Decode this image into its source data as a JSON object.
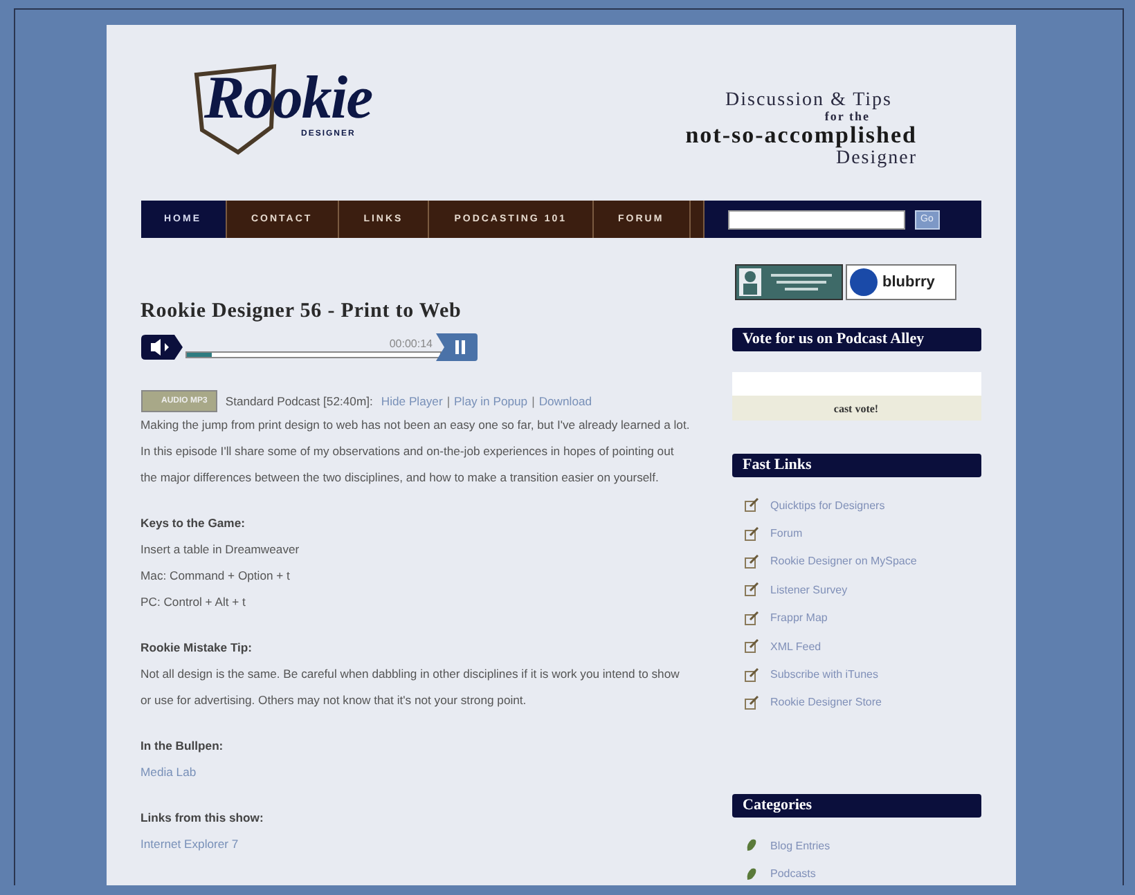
{
  "logo": {
    "word": "Rookie",
    "subword": "DESIGNER"
  },
  "tagline": {
    "lines": [
      {
        "text": "Discussion & Tips",
        "kind": "medium"
      },
      {
        "text": "for the",
        "kind": "small"
      },
      {
        "text": "not-so-accomplished",
        "kind": "large"
      },
      {
        "text": "Designer",
        "kind": "medium"
      }
    ]
  },
  "nav": {
    "items": [
      {
        "label": "HOME",
        "selected": true
      },
      {
        "label": "CONTACT",
        "selected": false
      },
      {
        "label": "LINKS",
        "selected": false
      },
      {
        "label": "PODCASTING 101",
        "selected": false
      },
      {
        "label": "FORUM",
        "selected": false
      }
    ],
    "search_button": "Go"
  },
  "post": {
    "title": "Rookie Designer 56 - Print to Web",
    "player": {
      "time": "00:00:14",
      "level": 0.1
    },
    "audio_badge": "AUDIO MP3",
    "podcast_info": "Standard Podcast [52:40m]:",
    "podcast_links": [
      "Hide Player",
      "Play in Popup",
      "Download"
    ],
    "separator": "|",
    "intro": "Making the jump from print design to web has not been an easy one so far, but I've already learned a lot. In this episode I'll share some of my observations and on-the-job experiences in hopes of pointing out the major differences between the two disciplines, and how to make a transition easier on yourself.",
    "sections": [
      {
        "heading": "Keys to the Game:",
        "lines": [
          {
            "text": "Insert a table in Dreamweaver",
            "kind": "text"
          },
          {
            "text": "Mac: Command + Option + t",
            "kind": "text"
          },
          {
            "text": "PC: Control + Alt + t",
            "kind": "text"
          }
        ]
      },
      {
        "heading": "Rookie Mistake Tip:",
        "lines": [
          {
            "text": "Not all design is the same. Be careful when dabbling in other disciplines if it is work you intend to show or use for advertising. Others may not know that it's not your strong point.",
            "kind": "text"
          }
        ]
      },
      {
        "heading": "In the Bullpen:",
        "lines": [
          {
            "text": "Media Lab",
            "kind": "link"
          }
        ]
      },
      {
        "heading": "Links from this show:",
        "lines": [
          {
            "text": "Internet Explorer 7",
            "kind": "link"
          }
        ]
      }
    ]
  },
  "sidebar": {
    "blubrry_badge": "blubrry",
    "vote": {
      "title": "Vote for us on Podcast Alley",
      "button": "cast vote!"
    },
    "fast_links": {
      "title": "Fast Links",
      "items": [
        "Quicktips for Designers",
        "Forum",
        "Rookie Designer on MySpace",
        "Listener Survey",
        "Frappr Map",
        "XML Feed",
        "Subscribe with iTunes",
        "Rookie Designer Store"
      ]
    },
    "categories": {
      "title": "Categories",
      "items": [
        "Blog Entries",
        "Podcasts"
      ]
    }
  }
}
